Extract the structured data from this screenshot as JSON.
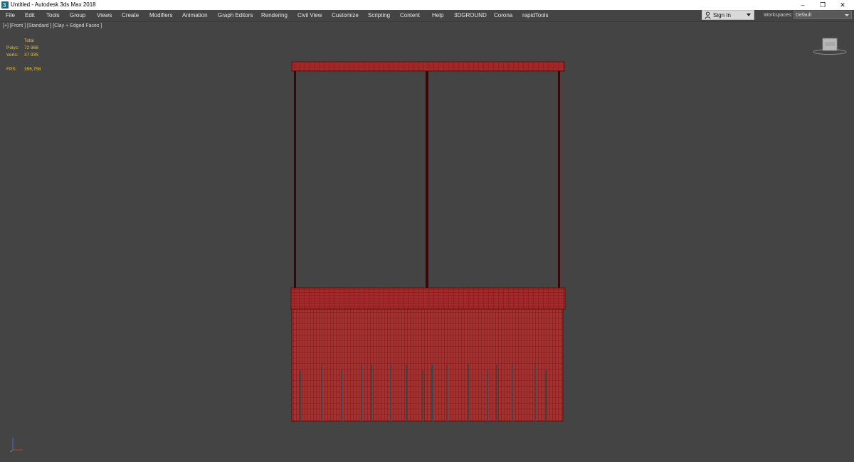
{
  "window": {
    "title": "Untitled - Autodesk 3ds Max 2018",
    "minimize_icon": "minimize-icon",
    "restore_icon": "restore-icon",
    "close_icon": "close-icon"
  },
  "menu": [
    {
      "label": "File"
    },
    {
      "label": "Edit"
    },
    {
      "label": "Tools"
    },
    {
      "label": "Group"
    },
    {
      "label": "Views"
    },
    {
      "label": "Create"
    },
    {
      "label": "Modifiers"
    },
    {
      "label": "Animation"
    },
    {
      "label": "Graph Editors"
    },
    {
      "label": "Rendering"
    },
    {
      "label": "Civil View"
    },
    {
      "label": "Customize"
    },
    {
      "label": "Scripting"
    },
    {
      "label": "Content"
    },
    {
      "label": "Help"
    },
    {
      "label": "3DGROUND"
    },
    {
      "label": "Corona"
    },
    {
      "label": "rapidTools"
    }
  ],
  "account": {
    "signin_label": "Sign In",
    "workspaces_label": "Workspaces:",
    "workspace_value": "Default"
  },
  "viewport": {
    "label": "[+] [Front ] [Standard ] [Clay + Edged Faces ]",
    "stats": {
      "header": "Total",
      "polys_label": "Polys:",
      "polys_value": "72 968",
      "verts_label": "Verts:",
      "verts_value": "37 935",
      "fps_label": "FPS:",
      "fps_value": "356,758"
    }
  },
  "colors": {
    "viewport_bg": "#444444",
    "model_fill": "#a32a2a",
    "model_wire": "#5a0a0a",
    "stats_text": "#e3c24a"
  }
}
